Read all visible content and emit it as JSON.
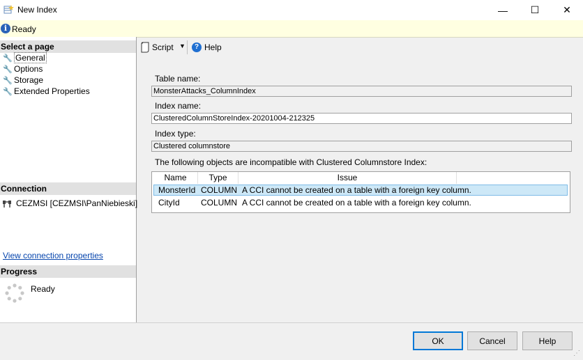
{
  "window": {
    "title": "New Index",
    "controls": {
      "minimize": "—",
      "maximize": "☐",
      "close": "✕"
    }
  },
  "status": {
    "icon": "info-icon",
    "text": "Ready"
  },
  "left_pane": {
    "select_page_header": "Select a page",
    "pages": [
      {
        "label": "General",
        "selected": true
      },
      {
        "label": "Options",
        "selected": false
      },
      {
        "label": "Storage",
        "selected": false
      },
      {
        "label": "Extended Properties",
        "selected": false
      }
    ],
    "connection_header": "Connection",
    "connection_text": "CEZMSI [CEZMSI\\PanNiebieski]",
    "view_connection_link": "View connection properties",
    "progress_header": "Progress",
    "progress_text": "Ready"
  },
  "toolbar": {
    "script_label": "Script",
    "help_label": "Help"
  },
  "form": {
    "table_name_label": "Table name:",
    "table_name_value": "MonsterAttacks_ColumnIndex",
    "index_name_label": "Index name:",
    "index_name_value": "ClusteredColumnStoreIndex-20201004-212325",
    "index_type_label": "Index type:",
    "index_type_value": "Clustered columnstore",
    "incompatible_label": "The following objects are incompatible with Clustered Columnstore Index:"
  },
  "grid": {
    "columns": [
      "Name",
      "Type",
      "Issue"
    ],
    "rows": [
      {
        "name": "MonsterId",
        "type": "COLUMN",
        "issue": "A CCI cannot be created on a table with a foreign key column.",
        "selected": true
      },
      {
        "name": "CityId",
        "type": "COLUMN",
        "issue": "A CCI cannot be created on a table with a foreign key column.",
        "selected": false
      }
    ]
  },
  "buttons": {
    "ok": "OK",
    "cancel": "Cancel",
    "help": "Help"
  },
  "colors": {
    "accent": "#0078d7",
    "status_strip": "#ffffe1",
    "selection": "#cde8f7",
    "link": "#0645ad"
  }
}
